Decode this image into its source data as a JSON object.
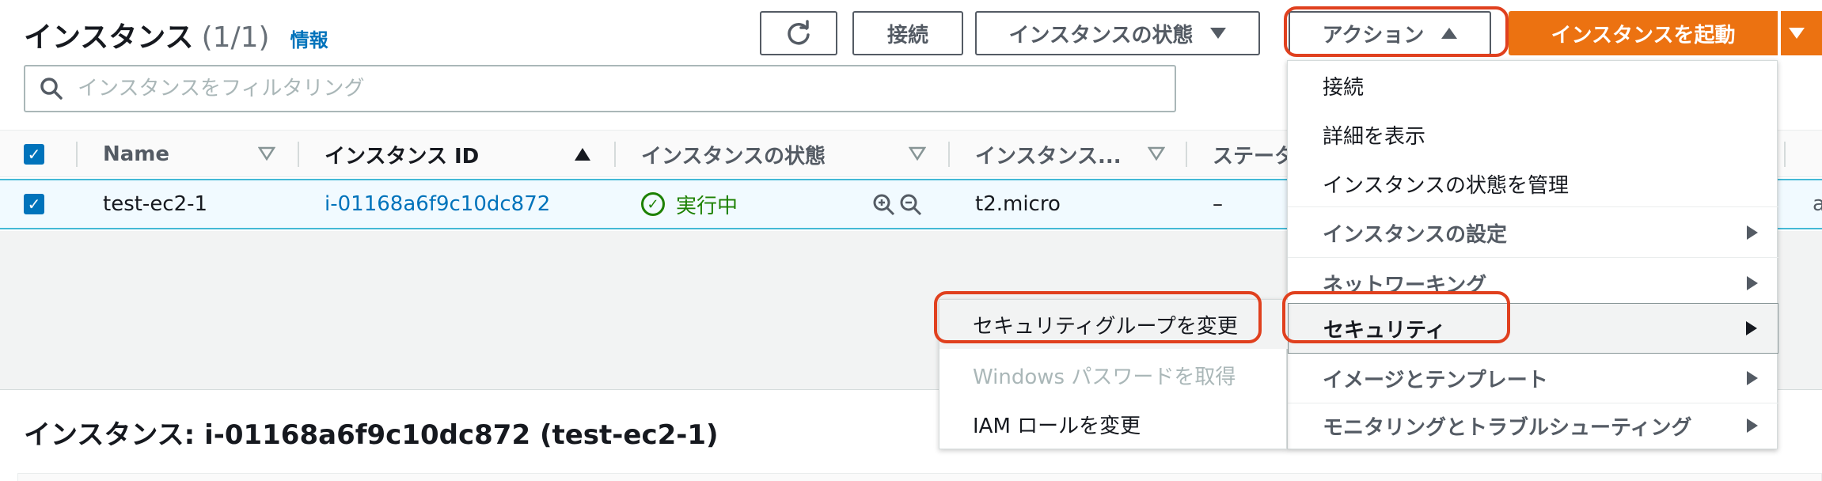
{
  "header": {
    "title": "インスタンス",
    "count": "(1/1)",
    "info_link": "情報"
  },
  "toolbar": {
    "connect_label": "接続",
    "instance_state_label": "インスタンスの状態",
    "actions_label": "アクション",
    "launch_label": "インスタンスを起動"
  },
  "search": {
    "placeholder": "インスタンスをフィルタリング"
  },
  "table": {
    "columns": [
      "Name",
      "インスタンス ID",
      "インスタンスの状態",
      "インスタンス...",
      "ステータ"
    ],
    "rows": [
      {
        "name": "test-ec2-1",
        "instance_id": "i-01168a6f9c10dc872",
        "state": "実行中",
        "type": "t2.micro",
        "status": "–"
      }
    ],
    "right_edge_fragment": "a"
  },
  "actions_menu": {
    "items": [
      {
        "label": "接続"
      },
      {
        "label": "詳細を表示"
      },
      {
        "label": "インスタンスの状態を管理"
      },
      {
        "label": "インスタンスの設定"
      },
      {
        "label": "ネットワーキング"
      },
      {
        "label": "セキュリティ"
      },
      {
        "label": "イメージとテンプレート"
      },
      {
        "label": "モニタリングとトラブルシューティング"
      }
    ]
  },
  "security_submenu": {
    "items": [
      {
        "label": "セキュリティグループを変更"
      },
      {
        "label": "Windows パスワードを取得"
      },
      {
        "label": "IAM ロールを変更"
      }
    ]
  },
  "details": {
    "title": "インスタンス: i-01168a6f9c10dc872 (test-ec2-1)"
  },
  "colors": {
    "accent": "#0073bb",
    "primary_button": "#ec7211",
    "highlight_outline": "#e0401e",
    "running": "#1d8102"
  }
}
